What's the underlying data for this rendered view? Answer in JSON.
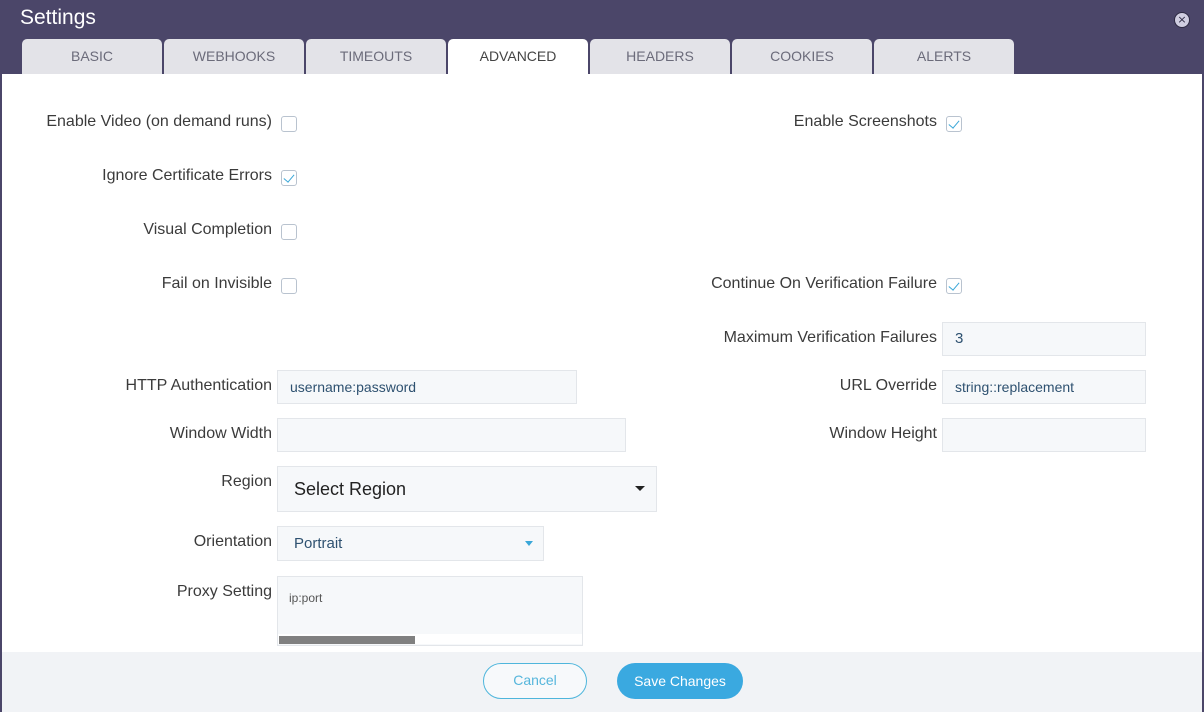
{
  "window": {
    "title": "Settings"
  },
  "tabs": [
    {
      "label": "BASIC"
    },
    {
      "label": "WEBHOOKS"
    },
    {
      "label": "TIMEOUTS"
    },
    {
      "label": "ADVANCED",
      "active": true
    },
    {
      "label": "HEADERS"
    },
    {
      "label": "COOKIES"
    },
    {
      "label": "ALERTS"
    }
  ],
  "form": {
    "enable_video": {
      "label": "Enable Video (on demand runs)",
      "checked": false
    },
    "enable_screenshots": {
      "label": "Enable Screenshots",
      "checked": true
    },
    "ignore_cert_errors": {
      "label": "Ignore Certificate Errors",
      "checked": true
    },
    "visual_completion": {
      "label": "Visual Completion",
      "checked": false
    },
    "fail_on_invisible": {
      "label": "Fail on Invisible",
      "checked": false
    },
    "continue_on_verification_failure": {
      "label": "Continue On Verification Failure",
      "checked": true
    },
    "max_verification_failures": {
      "label": "Maximum Verification Failures",
      "value": "3"
    },
    "http_auth": {
      "label": "HTTP Authentication",
      "placeholder": "username:password",
      "value": ""
    },
    "url_override": {
      "label": "URL Override",
      "placeholder": "string::replacement",
      "value": ""
    },
    "window_width": {
      "label": "Window Width",
      "value": ""
    },
    "window_height": {
      "label": "Window Height",
      "value": ""
    },
    "region": {
      "label": "Region",
      "selected": "Select Region"
    },
    "orientation": {
      "label": "Orientation",
      "selected": "Portrait"
    },
    "proxy": {
      "label": "Proxy Setting",
      "placeholder": "ip:port"
    }
  },
  "footer": {
    "cancel_label": "Cancel",
    "save_label": "Save Changes"
  },
  "colors": {
    "header_bg": "#4b4669",
    "accent": "#3aa9e0",
    "checkbox_check": "#3aa7d8"
  }
}
